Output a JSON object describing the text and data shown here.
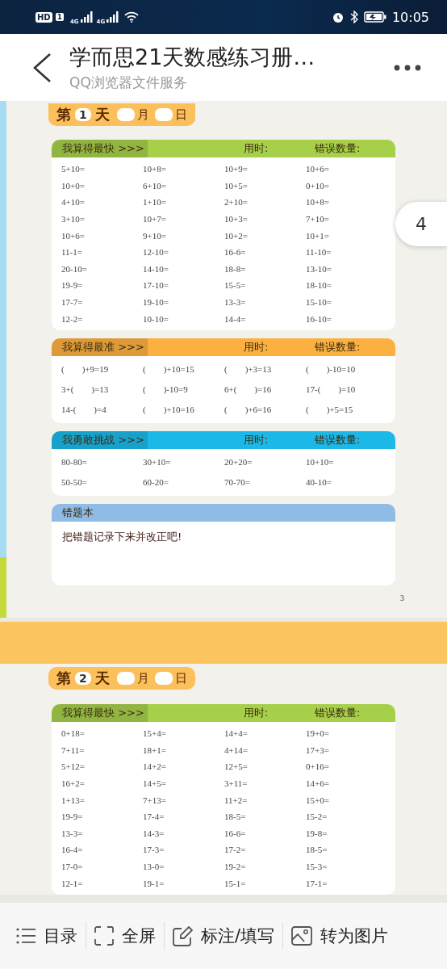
{
  "status_bar": {
    "hd": "HD",
    "sim": "1",
    "networks": [
      "4G",
      "4G"
    ],
    "time": "10:05"
  },
  "header": {
    "title": "学而思21天数感练习册…",
    "subtitle": "QQ浏览器文件服务"
  },
  "page_indicator": "4",
  "pages": [
    {
      "day_prefix": "第",
      "day": "1",
      "day_suffix": "天",
      "month_label": "月",
      "date_label": "日",
      "page_number": "3",
      "sections": [
        {
          "kind": "grid",
          "color": "#a6cf4a",
          "title": "我算得最快 >>>",
          "time_label": "用时:",
          "errors_label": "错误数量:",
          "rows": [
            [
              "5+10=",
              "10+8=",
              "10+9=",
              "10+6="
            ],
            [
              "10+0=",
              "6+10=",
              "10+5=",
              "0+10="
            ],
            [
              "4+10=",
              "1+10=",
              "2+10=",
              "10+8="
            ],
            [
              "3+10=",
              "10+7=",
              "10+3=",
              "7+10="
            ],
            [
              "10+6=",
              "9+10=",
              "10+2=",
              "10+1="
            ],
            [
              "11-1=",
              "12-10=",
              "16-6=",
              "11-10="
            ],
            [
              "20-10=",
              "14-10=",
              "18-8=",
              "13-10="
            ],
            [
              "19-9=",
              "17-10=",
              "15-5=",
              "18-10="
            ],
            [
              "17-7=",
              "19-10=",
              "13-3=",
              "15-10="
            ],
            [
              "12-2=",
              "10-10=",
              "14-4=",
              "16-10="
            ]
          ]
        },
        {
          "kind": "fill",
          "color": "#fbb040",
          "title": "我算得最准 >>>",
          "time_label": "用时:",
          "errors_label": "错误数量:",
          "rows": [
            [
              "(　　)+9=19",
              "(　　)+10=15",
              "(　　)+3=13",
              "(　　)-10=10"
            ],
            [
              "3+(　　)=13",
              "(　　)-10=9",
              "6+(　　)=16",
              "17-(　　)=10"
            ],
            [
              "14-(　　)=4",
              "(　　)+10=16",
              "(　　)+6=16",
              "(　　)+5=15"
            ]
          ]
        },
        {
          "kind": "fill",
          "color": "#1cb9e8",
          "title": "我勇敢挑战 >>>",
          "time_label": "用时:",
          "errors_label": "错误数量:",
          "rows": [
            [
              "80-80=",
              "30+10=",
              "20+20=",
              "10+10="
            ],
            [
              "50-50=",
              "60-20=",
              "70-70=",
              "40-10="
            ]
          ]
        },
        {
          "kind": "note",
          "color": "#8fbce6",
          "title": "错题本",
          "text": "把错题记录下来并改正吧!"
        }
      ]
    },
    {
      "day_prefix": "第",
      "day": "2",
      "day_suffix": "天",
      "month_label": "月",
      "date_label": "日",
      "sections": [
        {
          "kind": "grid",
          "color": "#a6cf4a",
          "title": "我算得最快 >>>",
          "time_label": "用时:",
          "errors_label": "错误数量:",
          "rows": [
            [
              "0+18=",
              "15+4=",
              "14+4=",
              "19+0="
            ],
            [
              "7+11=",
              "18+1=",
              "4+14=",
              "17+3="
            ],
            [
              "5+12=",
              "14+2=",
              "12+5=",
              "0+16="
            ],
            [
              "16+2=",
              "14+5=",
              "3+11=",
              "14+6="
            ],
            [
              "1+13=",
              "7+13=",
              "11+2=",
              "15+0="
            ],
            [
              "19-9=",
              "17-4=",
              "18-5=",
              "15-2="
            ],
            [
              "13-3=",
              "14-3=",
              "16-6=",
              "19-8="
            ],
            [
              "16-4=",
              "17-3=",
              "17-2=",
              "18-5="
            ],
            [
              "17-0=",
              "13-0=",
              "19-2=",
              "15-3="
            ],
            [
              "12-1=",
              "19-1=",
              "15-1=",
              "17-1="
            ]
          ]
        }
      ]
    }
  ],
  "toolbar": [
    {
      "kind": "list",
      "label": "目录"
    },
    {
      "kind": "fullscreen",
      "label": "全屏"
    },
    {
      "kind": "edit",
      "label": "标注/填写"
    },
    {
      "kind": "image",
      "label": "转为图片"
    }
  ]
}
